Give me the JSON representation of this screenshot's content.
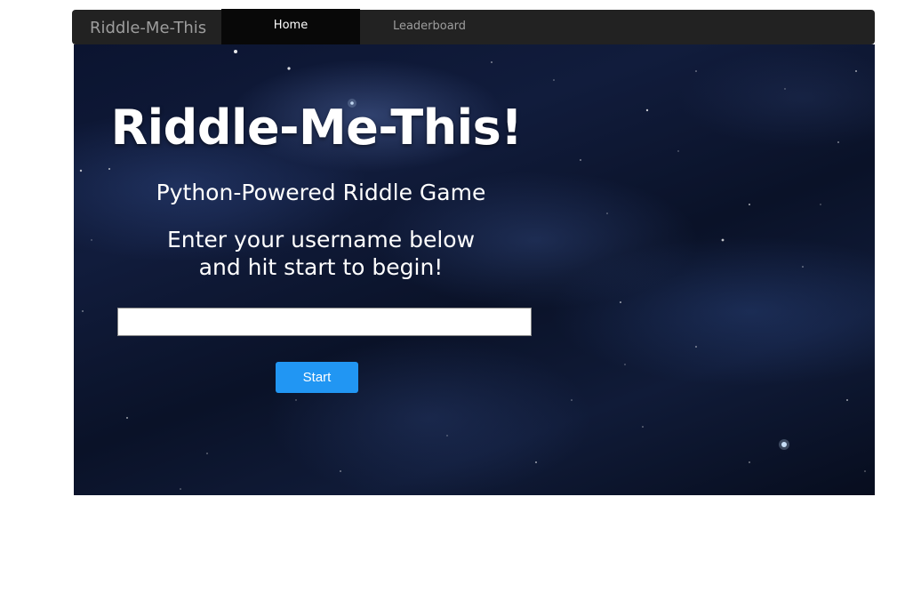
{
  "navbar": {
    "brand": "Riddle-Me-This",
    "tabs": [
      {
        "label": "Home",
        "active": true
      },
      {
        "label": "Leaderboard",
        "active": false
      }
    ]
  },
  "hero": {
    "title": "Riddle-Me-This!",
    "subtitle": "Python-Powered Riddle Game",
    "instructions_line1": "Enter your username below",
    "instructions_line2": "and hit start to begin!",
    "username_input": {
      "value": "",
      "placeholder": ""
    },
    "start_label": "Start"
  },
  "colors": {
    "navbar_bg": "#222222",
    "navbar_active_bg": "#080808",
    "navbar_text": "#9d9d9d",
    "button_bg": "#2196f3",
    "space_bg": "#0b1430"
  }
}
